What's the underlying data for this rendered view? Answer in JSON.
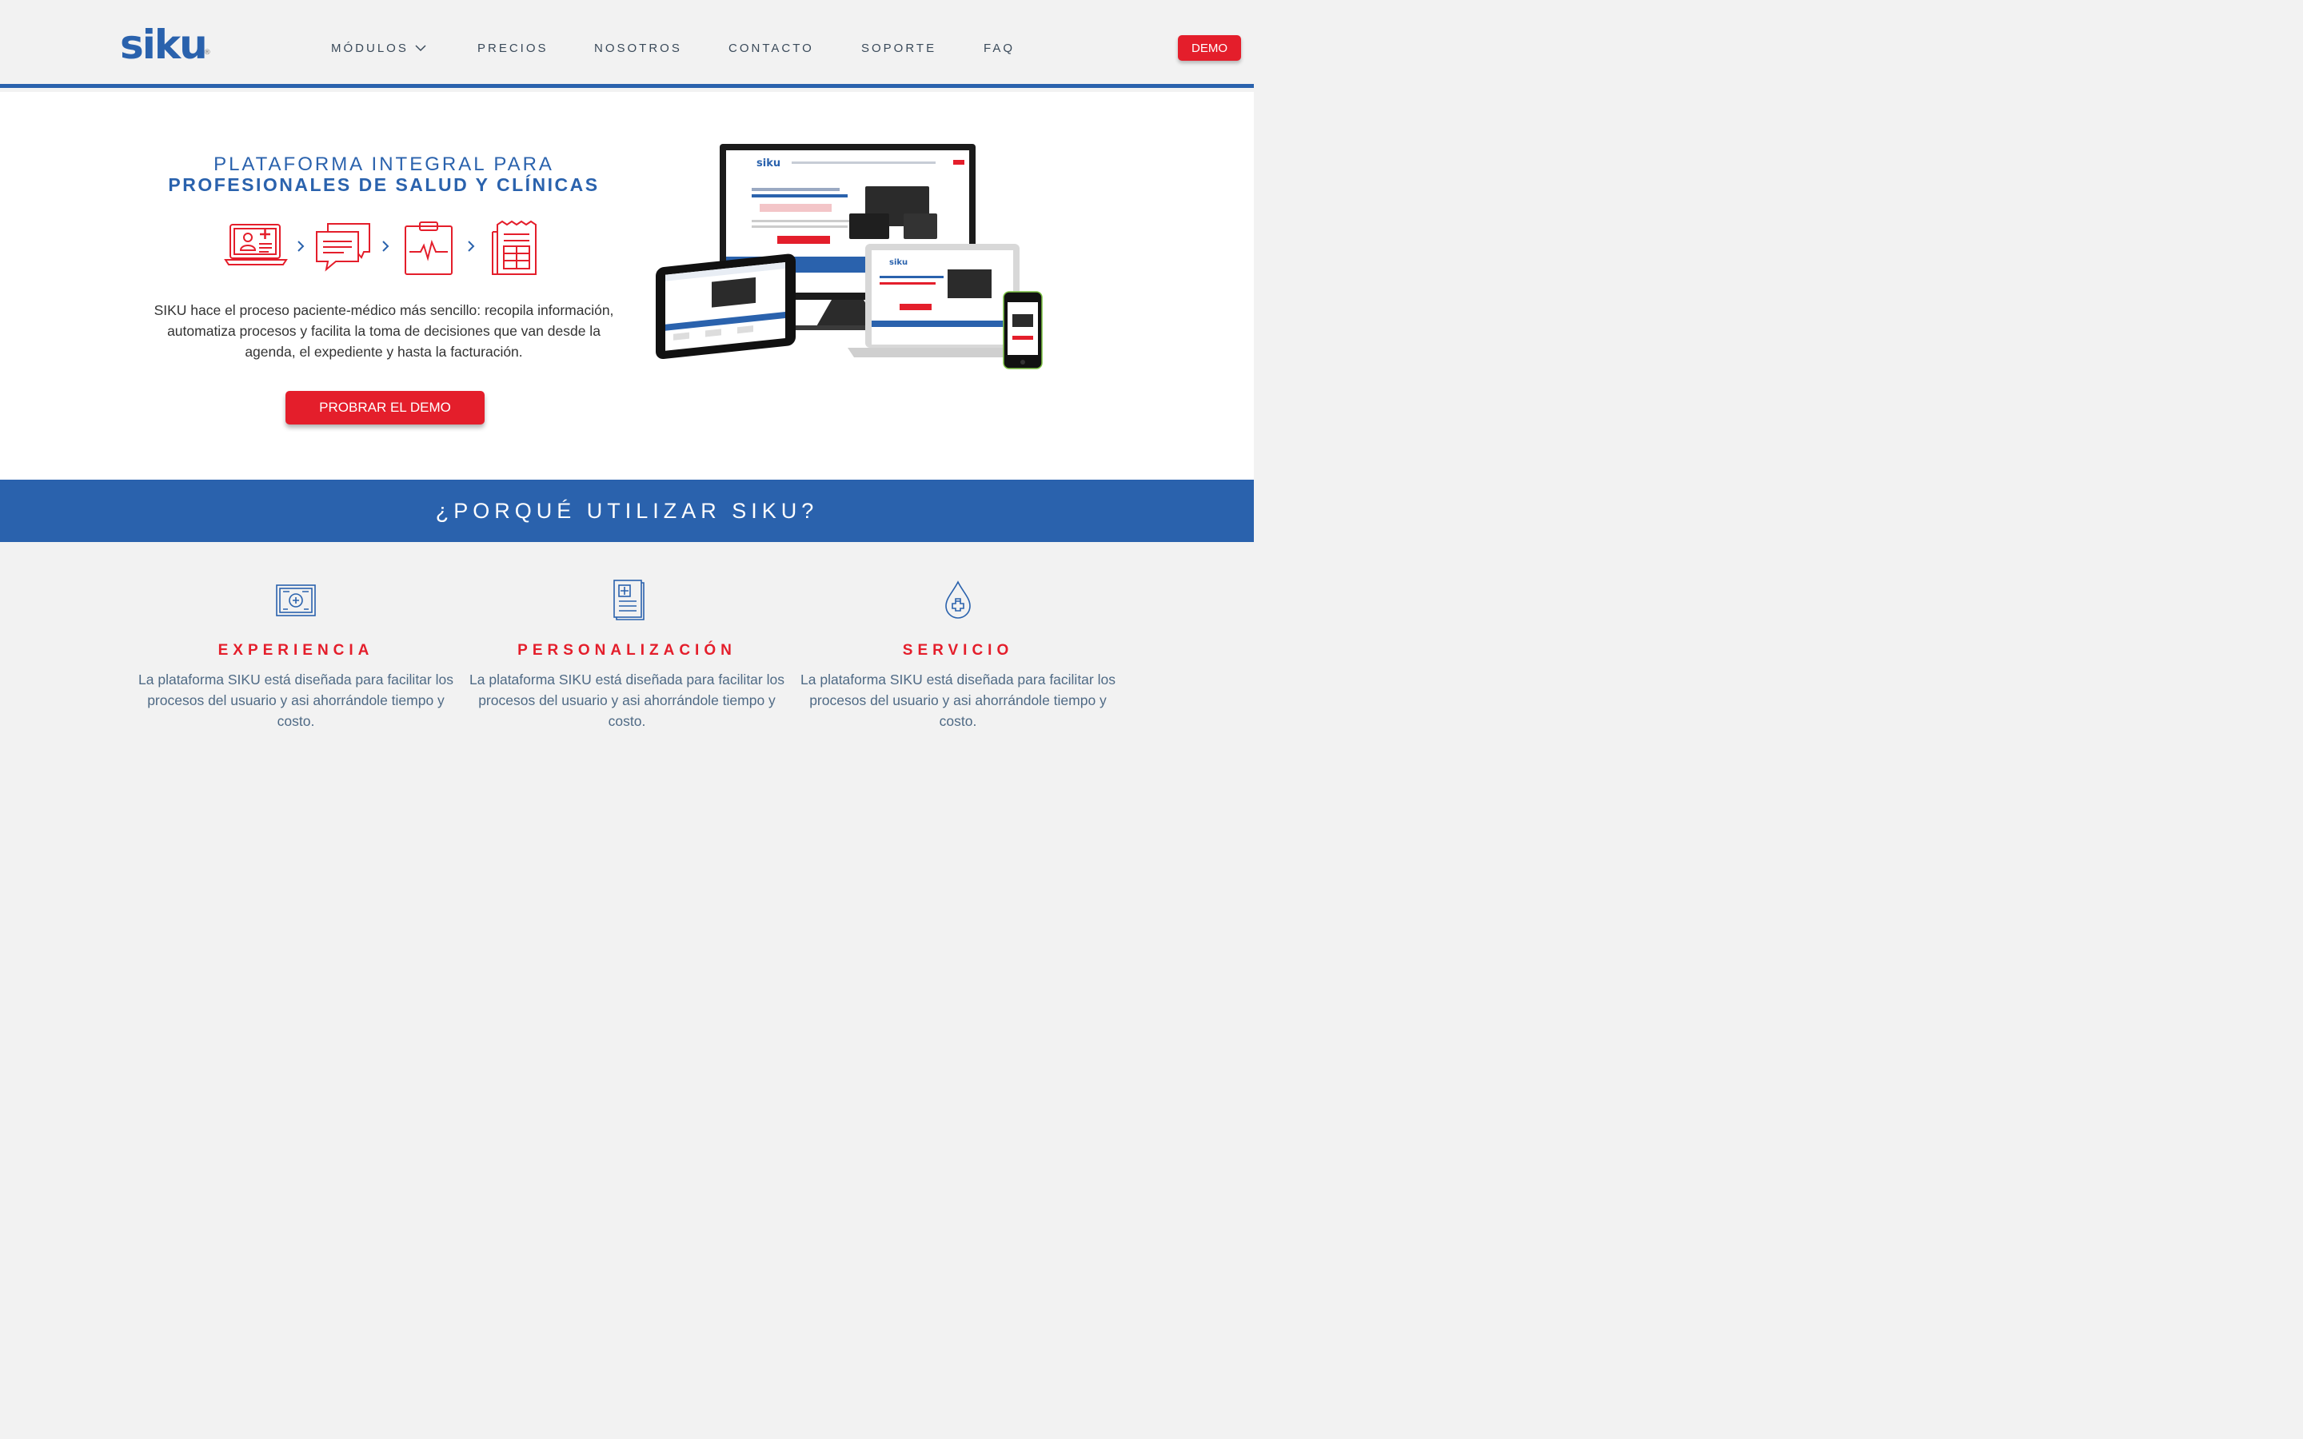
{
  "brand": {
    "name": "siku",
    "mark": "®",
    "accent": "#2a62ad",
    "red": "#e41e2b"
  },
  "nav": {
    "items": [
      "MÓDULOS",
      "PRECIOS",
      "NOSOTROS",
      "CONTACTO",
      "SOPORTE",
      "FAQ"
    ],
    "demo_label": "DEMO"
  },
  "hero": {
    "title_line1": "PLATAFORMA INTEGRAL PARA",
    "title_line2": "PROFESIONALES DE SALUD Y CLÍNICAS",
    "description": "SIKU hace el proceso paciente-médico más sencillo: recopila información, automatiza procesos y facilita la toma de decisiones que van desde la agenda, el expediente y hasta la facturación.",
    "cta_label": "PROBRAR EL DEMO",
    "flow_icons": [
      "laptop-doctor-icon",
      "chat-icon",
      "clipboard-heartbeat-icon",
      "invoice-icon"
    ]
  },
  "banner": {
    "title": "¿PORQUÉ UTILIZAR SIKU?"
  },
  "features": [
    {
      "icon": "certificate-icon",
      "title": "EXPERIENCIA",
      "description": "La plataforma SIKU está diseñada para facilitar los procesos del usuario y asi ahorrándole tiempo y costo."
    },
    {
      "icon": "medical-document-icon",
      "title": "PERSONALIZACIÓN",
      "description": "La plataforma SIKU está diseñada para facilitar los procesos del usuario y asi ahorrándole tiempo y costo."
    },
    {
      "icon": "drop-plus-icon",
      "title": "SERVICIO",
      "description": "La plataforma SIKU está diseñada para facilitar los procesos del usuario y asi ahorrándole tiempo y costo."
    }
  ]
}
